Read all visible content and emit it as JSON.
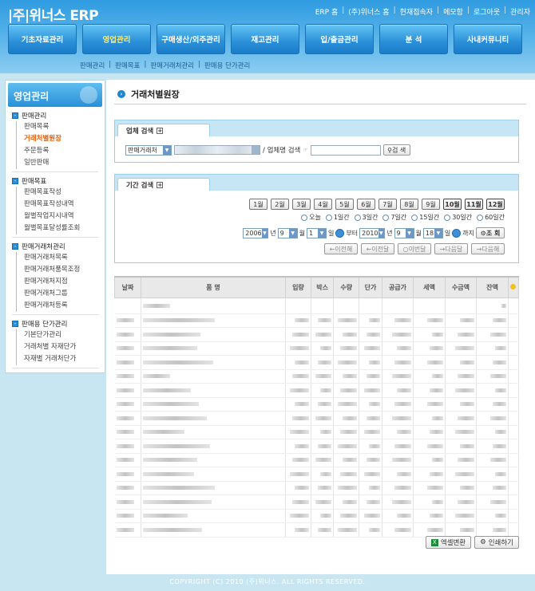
{
  "app": {
    "logo": "|주|위너스 ERP"
  },
  "top_links": [
    "ERP 홈",
    "(주)위너스 홈",
    "현재접속자",
    "메모함",
    "로그아웃",
    "관리자"
  ],
  "main_nav": [
    "기초자료관리",
    "영업관리",
    "구매생산/외주관리",
    "재고관리",
    "입/출금관리",
    "분 석",
    "사내커뮤니티"
  ],
  "main_nav_active": 1,
  "sub_nav": [
    "판매관리",
    "판매목표",
    "판매거래처관리",
    "판매용 단가관리"
  ],
  "sidebar": {
    "title": "영업관리",
    "groups": [
      {
        "title": "판매관리",
        "items": [
          "판매목록",
          "거래처별원장",
          "주문등록",
          "일반판매"
        ]
      },
      {
        "title": "판매목표",
        "items": [
          "판매목표작성",
          "판매목표작성내역",
          "월별작업지시내역",
          "월별목표달성률조회"
        ]
      },
      {
        "title": "판매거래처관리",
        "items": [
          "판매거래처목록",
          "판매거래처품목조정",
          "판매거래처지점",
          "판매거래처그룹",
          "판매거래처등록"
        ]
      },
      {
        "title": "판매용 단가관리",
        "items": [
          "기본단가관리",
          "거래처별 자재단가",
          "자재별 거래처단가"
        ]
      }
    ],
    "active_item": "거래처별원장"
  },
  "page": {
    "title": "거래처별원장"
  },
  "search_panel": {
    "title": "업체 검색",
    "type_select": "판매거래처",
    "label": "/ 업체명 검색",
    "search_button": "검 색"
  },
  "period_panel": {
    "title": "기간 검색",
    "months": [
      "1월",
      "2월",
      "3월",
      "4월",
      "5월",
      "6월",
      "7월",
      "8월",
      "9월",
      "10월",
      "11월",
      "12월"
    ],
    "bold_months": [
      9,
      10,
      11
    ],
    "ranges": [
      "오늘",
      "1일간",
      "3일간",
      "7일간",
      "15일간",
      "30일간",
      "60일간"
    ],
    "from": {
      "year": "2006",
      "month": "9",
      "day": "1"
    },
    "to": {
      "year": "2010",
      "month": "9",
      "day": "18"
    },
    "unit_year": "년",
    "unit_month": "월",
    "unit_day": "일",
    "from_label": "부터",
    "to_label": "까지",
    "query_button": "조 회",
    "nav_buttons": [
      "이전해",
      "이전달",
      "이번달",
      "다음달",
      "다음해"
    ]
  },
  "table": {
    "headers": [
      "날짜",
      "품 명",
      "입량",
      "박스",
      "수량",
      "단가",
      "공급가",
      "세액",
      "수금액",
      "잔액"
    ],
    "row_count": 17
  },
  "footer_buttons": {
    "excel": "엑셀변환",
    "print": "인쇄하기"
  },
  "copyright": "COPYRIGHT (C) 2010 (주)위너스. ALL RIGHTS RESERVED."
}
